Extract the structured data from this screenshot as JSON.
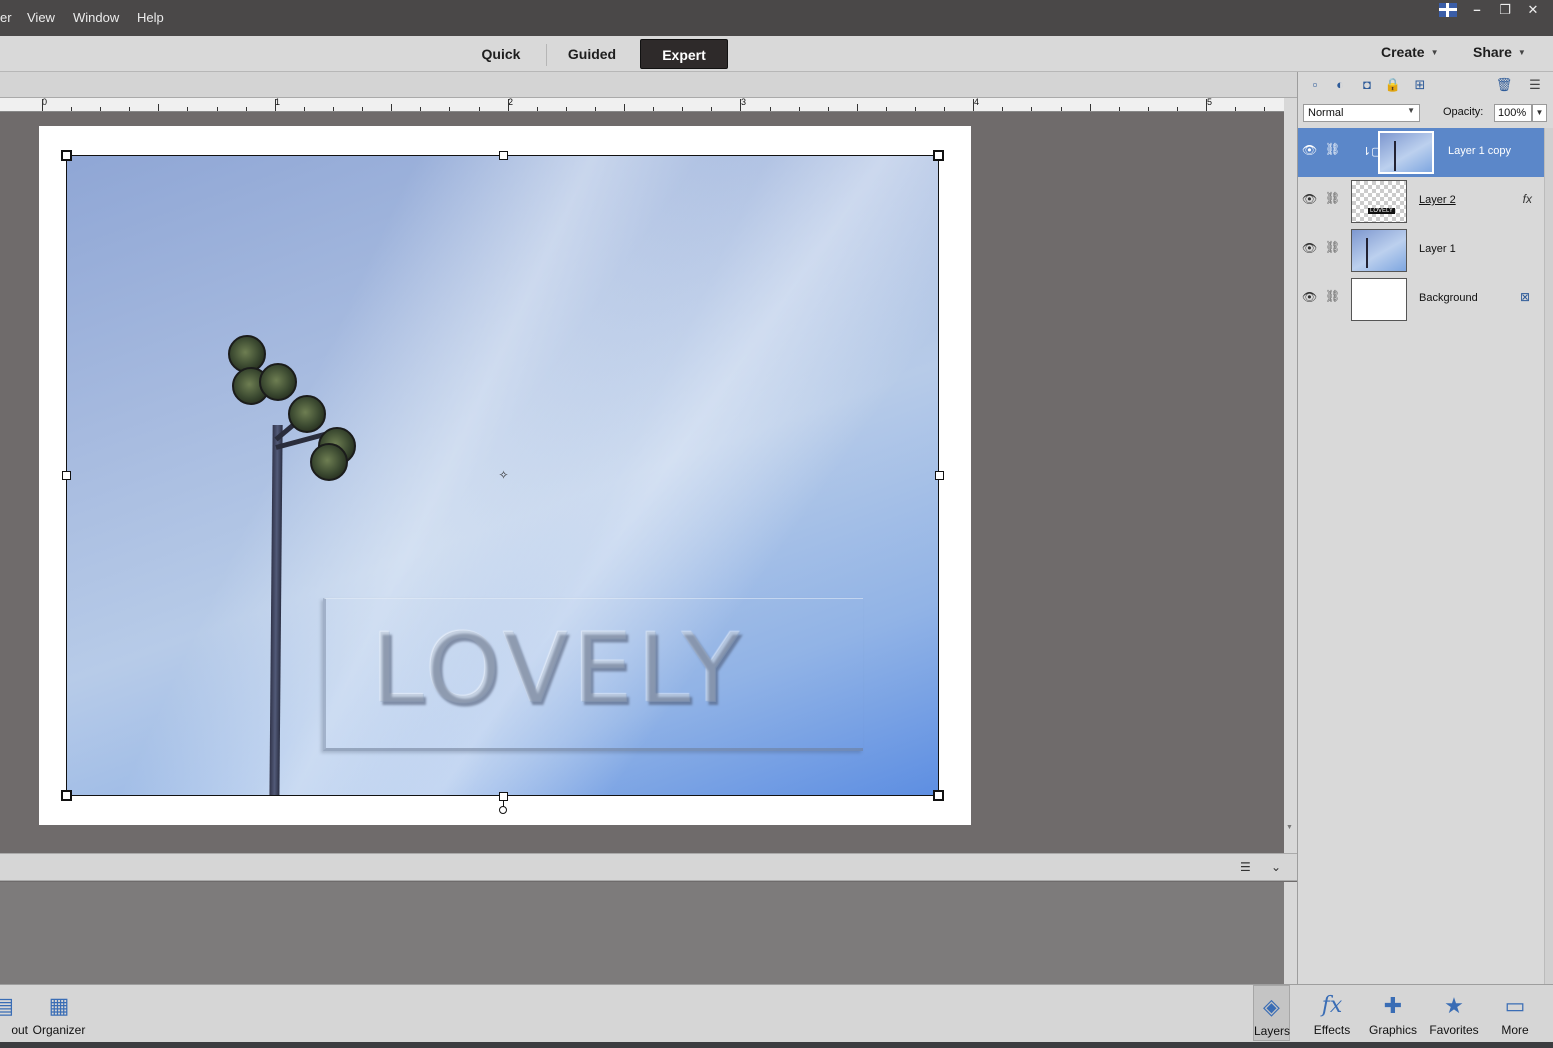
{
  "menubar": {
    "items": [
      "er",
      "View",
      "Window",
      "Help"
    ]
  },
  "modes": {
    "quick": "Quick",
    "guided": "Guided",
    "expert": "Expert",
    "active": "Expert"
  },
  "top_actions": {
    "create": "Create",
    "share": "Share"
  },
  "ruler": {
    "labels": [
      "0",
      "1",
      "2",
      "3",
      "4",
      "5"
    ]
  },
  "canvas": {
    "text": "LOVELY"
  },
  "layers_panel": {
    "blend_mode": "Normal",
    "opacity_label": "Opacity:",
    "opacity_value": "100%",
    "layers": [
      {
        "name": "Layer 1 copy",
        "selected": true
      },
      {
        "name": "Layer 2",
        "effect_icon": "fx"
      },
      {
        "name": "Layer 1"
      },
      {
        "name": "Background",
        "locked": true
      }
    ]
  },
  "taskbar": {
    "left": [
      {
        "label": "out",
        "icon": "layout-icon"
      },
      {
        "label": "Organizer",
        "icon": "organizer-icon"
      }
    ],
    "right": [
      {
        "label": "Layers",
        "icon": "layers-icon",
        "active": true
      },
      {
        "label": "Effects",
        "icon": "fx-icon"
      },
      {
        "label": "Graphics",
        "icon": "plus-icon"
      },
      {
        "label": "Favorites",
        "icon": "star-icon"
      },
      {
        "label": "More",
        "icon": "more-icon"
      }
    ]
  },
  "colors": {
    "accent": "#5b87c9",
    "active_mode_bg": "#2e2a2a",
    "icon_blue": "#3a6db5"
  }
}
